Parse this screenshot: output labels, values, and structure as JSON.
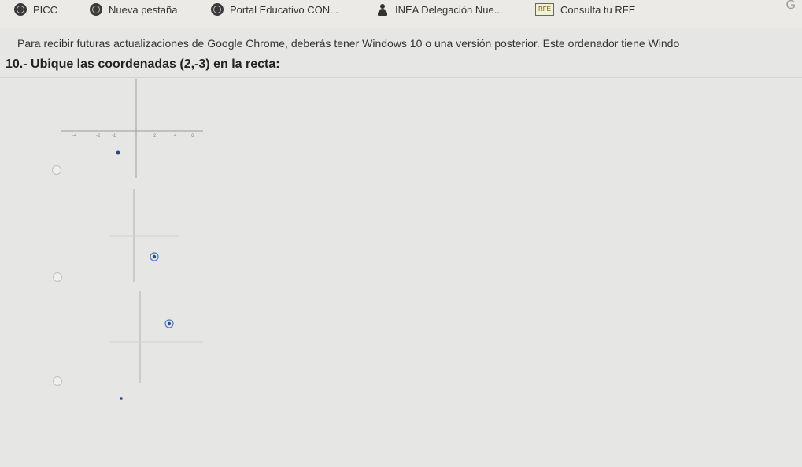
{
  "bookmarks": [
    {
      "label": "PICC",
      "icon": "globe-icon"
    },
    {
      "label": "Nueva pestaña",
      "icon": "globe-icon"
    },
    {
      "label": "Portal Educativo CON...",
      "icon": "globe-icon"
    },
    {
      "label": "INEA Delegación Nue...",
      "icon": "person-icon"
    },
    {
      "label": "Consulta tu RFE",
      "icon": "rfe-icon"
    }
  ],
  "infobar": {
    "text": "Para recibir futuras actualizaciones de Google Chrome, deberás tener Windows 10 o una versión posterior. Este ordenador tiene Windo"
  },
  "question": {
    "text": "10.- Ubique las coordenadas (2,-3) en la recta:"
  },
  "options": [
    {
      "id": "a",
      "point": [
        -1,
        -2
      ],
      "marker": "dot"
    },
    {
      "id": "b",
      "point": [
        2,
        -3
      ],
      "marker": "ring"
    },
    {
      "id": "c",
      "point": [
        2,
        2
      ],
      "marker": "ring"
    }
  ]
}
